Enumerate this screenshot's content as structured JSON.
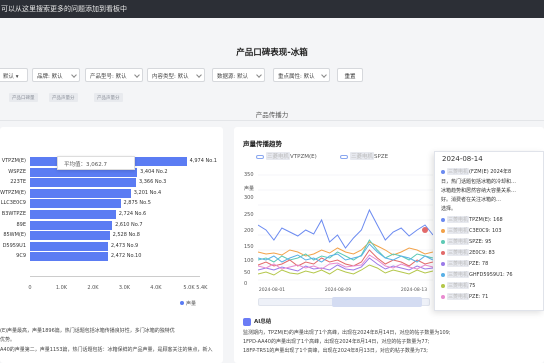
{
  "topbar": {
    "text": "可以从这里搜索更多的问题添加到看板中"
  },
  "page_title": "产品口碑表现-冰箱",
  "filters": [
    {
      "label": "默认 ▾"
    },
    {
      "label": "品牌: 默认"
    },
    {
      "label": "产品型号: 默认"
    },
    {
      "label": "内容类型: 默认"
    },
    {
      "label": "数据源: 默认"
    },
    {
      "label": "重点属性: 默认"
    }
  ],
  "reset_label": "重置",
  "tags": [
    "产品口碑量",
    "产品声量分",
    "产品声量分"
  ],
  "section_title": "产品传播力",
  "left_chart": {
    "avg_label": "平均值：3,062.7",
    "legend": "声量",
    "rows": [
      {
        "label": "VTPZM(E)",
        "value": 4974,
        "value_label": "4,974 No.1"
      },
      {
        "label": "WSPZE",
        "value": 3404,
        "value_label": "3,404 No.2"
      },
      {
        "label": "223TE",
        "value": 3366,
        "value_label": "3,366 No.3"
      },
      {
        "label": "WTPZM(E)",
        "value": 3201,
        "value_label": "3,201 No.4"
      },
      {
        "label": "LLC3E0C9",
        "value": 2875,
        "value_label": "2,875 No.5"
      },
      {
        "label": "B3WTPZE",
        "value": 2724,
        "value_label": "2,724 No.6"
      },
      {
        "label": "89E",
        "value": 2610,
        "value_label": "2,610 No.7"
      },
      {
        "label": "85WM(E)",
        "value": 2528,
        "value_label": "2,528 No.8"
      },
      {
        "label": "D5959U1",
        "value": 2473,
        "value_label": "2,473 No.9"
      },
      {
        "label": "9C9",
        "value": 2472,
        "value_label": "2,472 No.10"
      }
    ],
    "ticks": [
      "0",
      "1.0K",
      "2.0K",
      "3.0K",
      "4.0K",
      "5.0K 5.4K"
    ],
    "bottom_lines": [
      "(E)声量最高，声量1896篇，热门话题包括冰箱传播良好性，多门冰箱的独特优",
      "优势。",
      "A40的声量第二，声量1153篇，热门话题包括：冰箱保鲜的产品声量，是顾客关注的焦点，新入"
    ]
  },
  "chart_data": {
    "type": "bar",
    "title": "",
    "categories": [
      "VTPZM(E)",
      "WSPZE",
      "223TE",
      "WTPZM(E)",
      "LLC3E0C9",
      "B3WTPZE",
      "89E",
      "85WM(E)",
      "D5959U1",
      "9C9"
    ],
    "values": [
      4974,
      3404,
      3366,
      3201,
      2875,
      2724,
      2610,
      2528,
      2473,
      2472
    ],
    "xlim": [
      0,
      5400
    ],
    "legend": "声量"
  },
  "right_chart": {
    "title": "声量传播趋势",
    "legend_items": [
      "VTPZM(E)",
      "SPZE"
    ],
    "y_label": "声量",
    "y_ticks": [
      "350",
      "300",
      "250",
      "200",
      "150",
      "100",
      "50",
      "0"
    ],
    "x_ticks": [
      "2024-08-01",
      "2024-08-09",
      "2024-08-13"
    ],
    "colors": [
      "#6b8af0",
      "#f2a24a",
      "#5ec9b5",
      "#e26a6a",
      "#9b7ae8",
      "#59b0e6",
      "#b4c74a",
      "#e88bd0"
    ]
  },
  "tooltip": {
    "date": "2024-08-14",
    "intro": "(FZM(E) 2024年8",
    "lines_para": [
      "日，热门话题包括冰箱的冷却和…",
      "冰箱趋势和居然容纳大容量关系…",
      "好。消费者在关注冰箱的…",
      "选择。"
    ],
    "series": [
      {
        "name": "TPZM(E): 168",
        "color": "#6b8af0"
      },
      {
        "name": "C3E0C9: 103",
        "color": "#f2a24a"
      },
      {
        "name": "SPZE: 95",
        "color": "#5ec9b5"
      },
      {
        "name": "2E0C9: 83",
        "color": "#e26a6a"
      },
      {
        "name": "PZE: 78",
        "color": "#9b7ae8"
      },
      {
        "name": "GHFD5959U1: 76",
        "color": "#59b0e6"
      },
      {
        "name": "75",
        "color": "#b4c74a"
      },
      {
        "name": "PZE: 71",
        "color": "#e88bd0"
      }
    ]
  },
  "ai_summary": {
    "heading": "AI总结",
    "lines": [
      "监测期内，TPZM(E)的声量出现了1个高峰，出现在2024年8月14日，对应的帖子数量为109;",
      "1FPD-AA40的声量出现了1个高峰，出现在2024年8月14日，对应的帖子数量为77;",
      "18FP-TR51的声量出现了1个高峰，出现在2024年8月13日，对应的帖子数量为73;"
    ]
  }
}
